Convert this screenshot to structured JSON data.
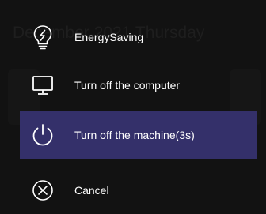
{
  "background": {
    "date_text": "December 2021 Thursday"
  },
  "menu": {
    "items": [
      {
        "label": "EnergySaving",
        "icon": "bulb-icon"
      },
      {
        "label": "Turn off the computer",
        "icon": "monitor-icon"
      },
      {
        "label": "Turn off the machine(3s)",
        "icon": "power-icon"
      },
      {
        "label": "Cancel",
        "icon": "cancel-icon"
      }
    ],
    "selected_index": 2
  },
  "colors": {
    "background": "#121212",
    "selected_background": "#34306a",
    "text": "#ffffff"
  }
}
